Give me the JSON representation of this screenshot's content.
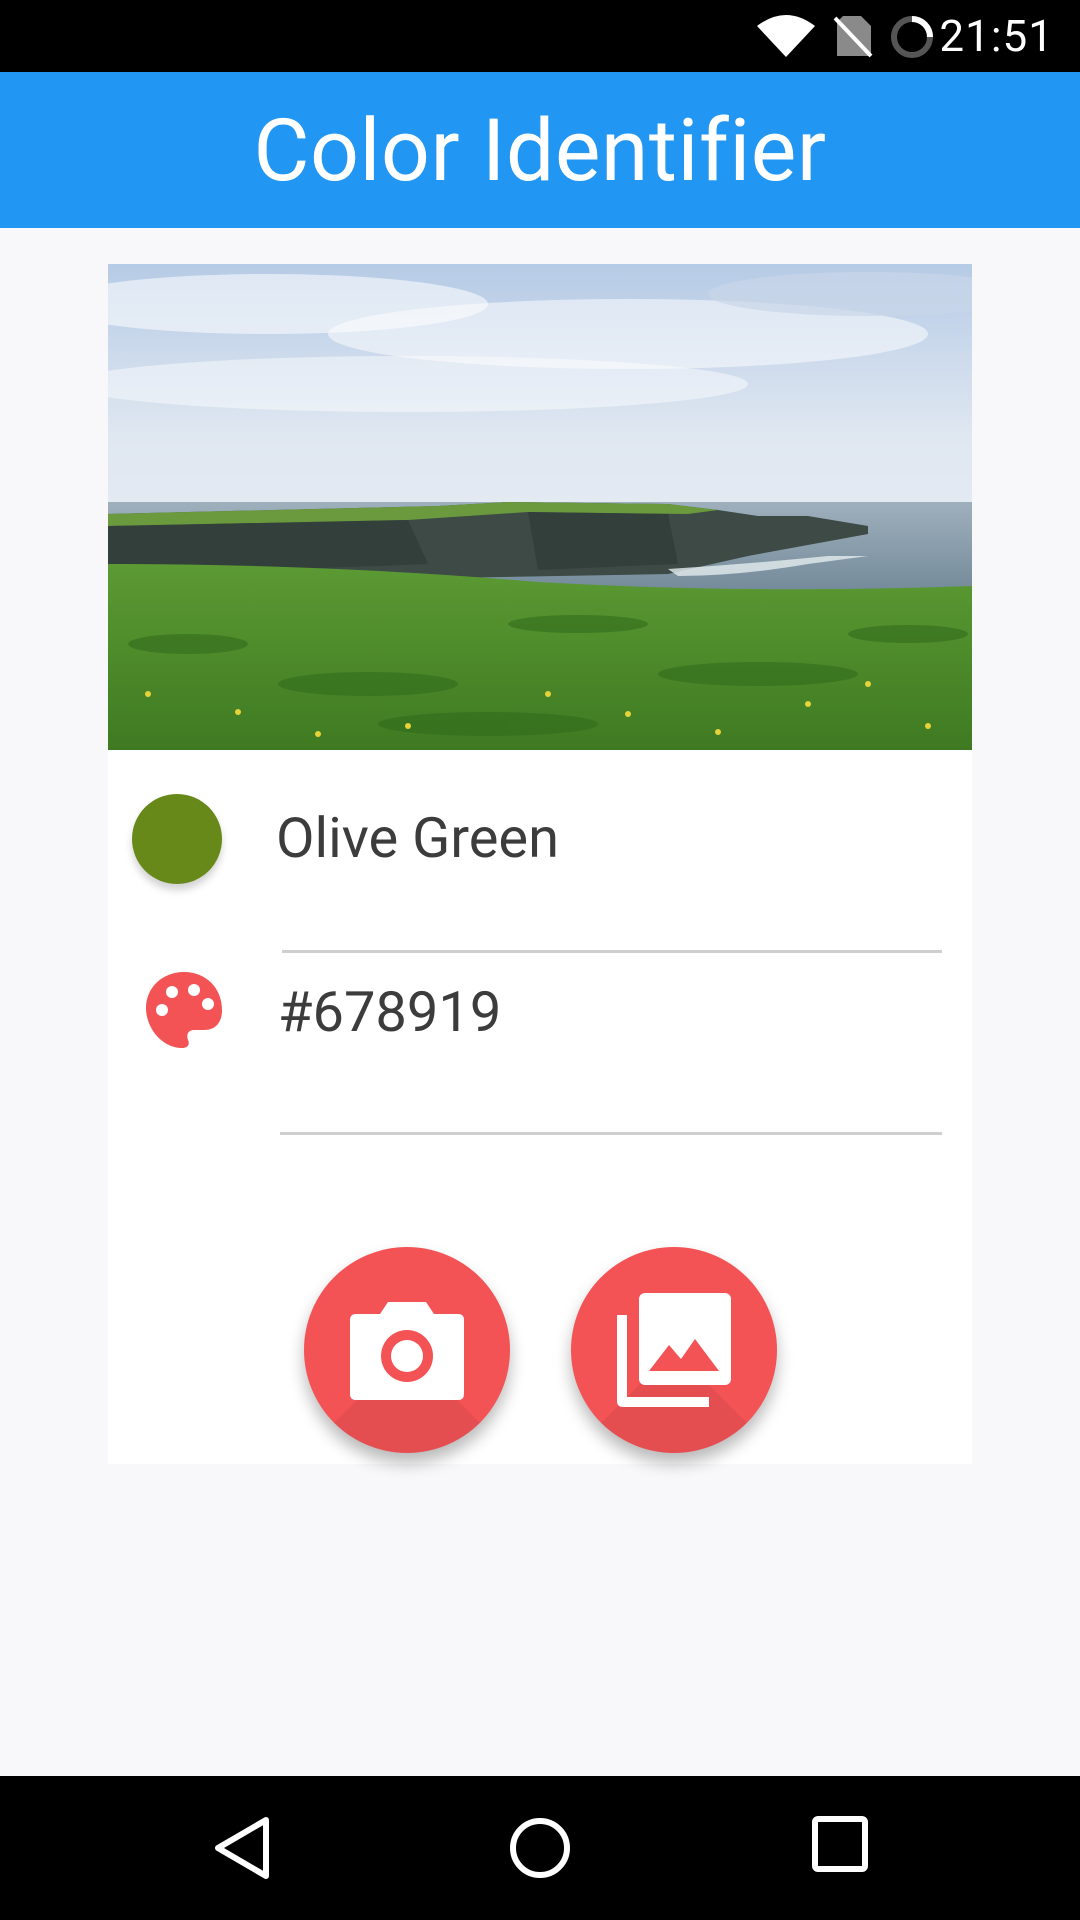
{
  "status_bar": {
    "time": "21:51",
    "icons": [
      "wifi-icon",
      "no-sim-icon",
      "loading-icon"
    ]
  },
  "app_bar": {
    "title": "Color Identifier",
    "color": "#2196f3"
  },
  "result": {
    "color_name": "Olive Green",
    "hex_code": "#678919",
    "swatch_color": "#678919"
  },
  "actions": {
    "camera_icon": "camera-icon",
    "gallery_icon": "gallery-icon",
    "fab_color": "#f45356"
  },
  "nav_bar": {
    "icons": [
      "back-icon",
      "home-icon",
      "recents-icon"
    ]
  }
}
